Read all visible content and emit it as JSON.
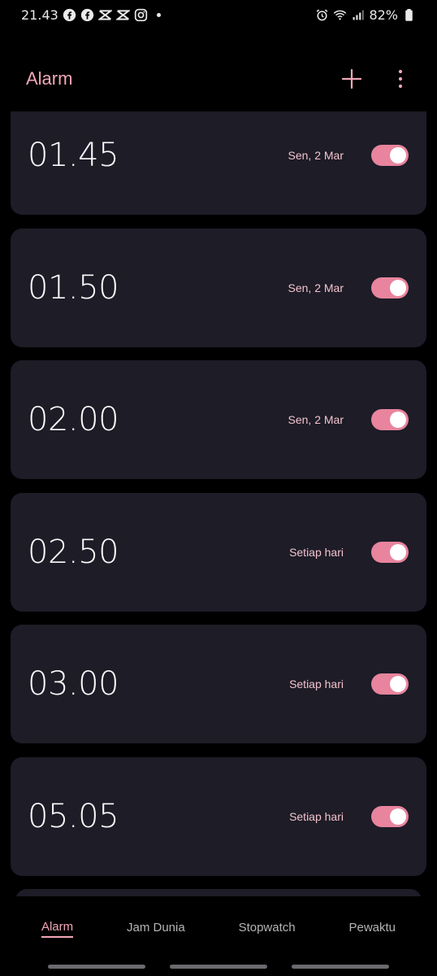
{
  "status_bar": {
    "time": "21.43",
    "battery": "82%",
    "left_icons": [
      "facebook-icon",
      "facebook-icon",
      "capcut-icon",
      "capcut-icon",
      "instagram-icon"
    ],
    "right_icons": [
      "alarm-icon",
      "wifi-icon",
      "signal-icon",
      "battery-icon"
    ]
  },
  "header": {
    "title": "Alarm",
    "add_icon": "plus-icon",
    "more_icon": "more-vertical-icon"
  },
  "alarms": [
    {
      "time": "01.45",
      "schedule": "Sen, 2 Mar",
      "enabled": true
    },
    {
      "time": "01.50",
      "schedule": "Sen, 2 Mar",
      "enabled": true
    },
    {
      "time": "02.00",
      "schedule": "Sen, 2 Mar",
      "enabled": true
    },
    {
      "time": "02.50",
      "schedule": "Setiap hari",
      "enabled": true
    },
    {
      "time": "03.00",
      "schedule": "Setiap hari",
      "enabled": true
    },
    {
      "time": "05.05",
      "schedule": "Setiap hari",
      "enabled": true
    }
  ],
  "bottom_nav": {
    "tabs": [
      "Alarm",
      "Jam Dunia",
      "Stopwatch",
      "Pewaktu"
    ],
    "active": 0
  },
  "colors": {
    "accent": "#f2a7b7",
    "toggle_on": "#e8849d",
    "card_bg": "#1d1c27",
    "background": "#000000"
  }
}
